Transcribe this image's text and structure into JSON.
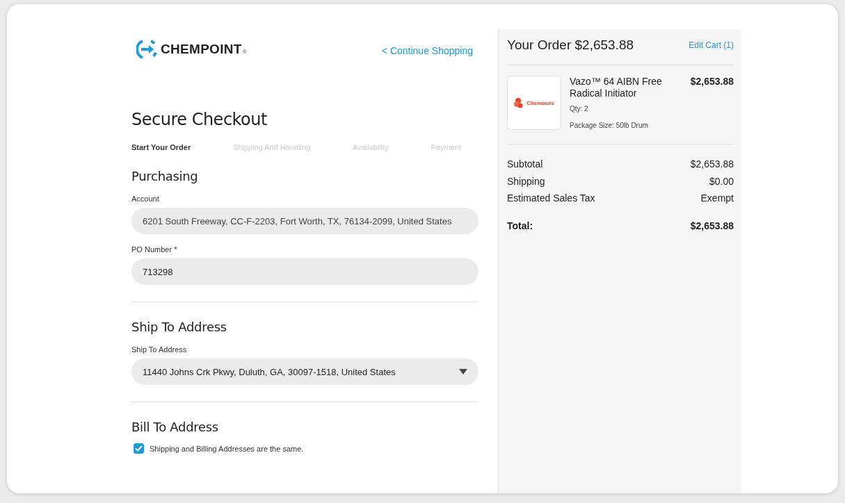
{
  "logo": {
    "name": "CHEMPOINT",
    "mark": "®"
  },
  "continue_link": "< Continue Shopping",
  "title": "Secure Checkout",
  "steps": [
    {
      "label": "Start Your Order",
      "selected": true
    },
    {
      "label": "Shipping And Handling",
      "selected": false
    },
    {
      "label": "Availability",
      "selected": false
    },
    {
      "label": "Payment",
      "selected": false
    }
  ],
  "purchasing": {
    "heading": "Purchasing",
    "fields": [
      {
        "label": "Account",
        "value": "6201 South Freeway, CC-F-2203, Fort Worth, TX, 76134-2099, United States",
        "kind": "readonly"
      },
      {
        "label": "PO Number *",
        "value": "713298",
        "kind": "text"
      }
    ]
  },
  "ship_to": {
    "heading": "Ship To Address",
    "label": "Ship To Address",
    "value": "11440 Johns Crk Pkwy, Duluth, GA, 30097-1518, United States"
  },
  "bill_to": {
    "heading": "Bill To Address",
    "same_address": {
      "label": "Shipping and Billing Addresses are the same.",
      "checked": true
    }
  },
  "order": {
    "title": "Your Order $2,653.88",
    "edit_link": "Edit Cart (1)",
    "item": {
      "brand": "Chemours",
      "name": "Vazo™ 64 AIBN Free Radical Initiator",
      "price": "$2,653.88",
      "qty": "Qty: 2",
      "package": "Package Size: 50lb Drum"
    },
    "summary": [
      {
        "label": "Subtotal",
        "value": "$2,653.88"
      },
      {
        "label": "Shipping",
        "value": "$0.00"
      },
      {
        "label": "Estimated Sales Tax",
        "value": "Exempt"
      }
    ],
    "total": {
      "label": "Total:",
      "value": "$2,653.88"
    }
  }
}
